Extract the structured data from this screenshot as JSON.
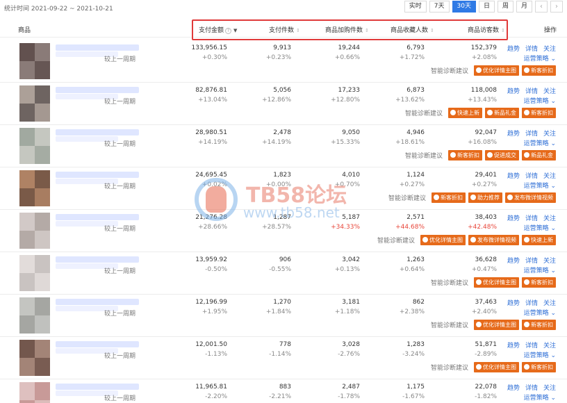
{
  "date_range": "统计时间 2021-09-22 ~ 2021-10-21",
  "range_tabs": [
    "实时",
    "7天",
    "30天",
    "日",
    "周",
    "月"
  ],
  "active_tab": "30天",
  "nav": {
    "prev": "‹",
    "next": "›"
  },
  "header": {
    "product": "商品",
    "pay_amount": "支付金额",
    "pay_items": "支付件数",
    "cart_items": "商品加购件数",
    "favorites": "商品收藏人数",
    "visitors": "商品访客数",
    "actions": "操作"
  },
  "compare_label": "较上一周期",
  "diag_label": "智能诊断建议",
  "ops": {
    "trend": "趋势",
    "detail": "详情",
    "follow": "关注",
    "strategy": "运营策略"
  },
  "colors": {
    "accent": "#2f7ae5",
    "tag": "#e66a1a",
    "highlight": "#e03a3a",
    "rise": "#e8463a"
  },
  "watermark": {
    "title": "TB58论坛",
    "url": "www.tb58.net"
  },
  "rows": [
    {
      "pay": "133,956.15",
      "pay_c": "+0.30%",
      "items": "9,913",
      "items_c": "+0.23%",
      "cart": "19,244",
      "cart_c": "+0.66%",
      "fav": "6,793",
      "fav_c": "+1.72%",
      "uv": "152,379",
      "uv_c": "+2.08%",
      "tags": [
        "优化详情主图",
        "新客折扣"
      ]
    },
    {
      "pay": "82,876.81",
      "pay_c": "+13.04%",
      "items": "5,056",
      "items_c": "+12.86%",
      "cart": "17,233",
      "cart_c": "+12.80%",
      "fav": "6,873",
      "fav_c": "+13.62%",
      "uv": "118,008",
      "uv_c": "+13.43%",
      "tags": [
        "快速上新",
        "新品礼金",
        "新客折扣"
      ]
    },
    {
      "pay": "28,980.51",
      "pay_c": "+14.19%",
      "items": "2,478",
      "items_c": "+14.19%",
      "cart": "9,050",
      "cart_c": "+15.33%",
      "fav": "4,946",
      "fav_c": "+18.61%",
      "uv": "92,047",
      "uv_c": "+16.08%",
      "tags": [
        "新客折扣",
        "促进成交",
        "新品礼金"
      ]
    },
    {
      "pay": "24,695.45",
      "pay_c": "+0.02%",
      "items": "1,823",
      "items_c": "+0.00%",
      "cart": "4,010",
      "cart_c": "+0.70%",
      "fav": "1,124",
      "fav_c": "+0.27%",
      "uv": "29,401",
      "uv_c": "+0.27%",
      "tags": [
        "新客折扣",
        "助力推荐",
        "发布微详情视频"
      ]
    },
    {
      "pay": "21,276.28",
      "pay_c": "+28.66%",
      "items": "1,287",
      "items_c": "+28.57%",
      "cart": "5,187",
      "cart_c": "+34.33%",
      "cart_red": true,
      "fav": "2,571",
      "fav_c": "+44.68%",
      "fav_red": true,
      "uv": "38,403",
      "uv_c": "+42.48%",
      "uv_red": true,
      "tags": [
        "优化详情主图",
        "发布微详情视频",
        "快速上新"
      ]
    },
    {
      "pay": "13,959.92",
      "pay_c": "-0.50%",
      "items": "906",
      "items_c": "-0.55%",
      "cart": "3,042",
      "cart_c": "+0.13%",
      "fav": "1,263",
      "fav_c": "+0.64%",
      "uv": "36,628",
      "uv_c": "+0.47%",
      "tags": [
        "优化详情主图",
        "新客折扣"
      ]
    },
    {
      "pay": "12,196.99",
      "pay_c": "+1.95%",
      "items": "1,270",
      "items_c": "+1.84%",
      "cart": "3,181",
      "cart_c": "+1.18%",
      "fav": "862",
      "fav_c": "+2.38%",
      "uv": "37,463",
      "uv_c": "+2.40%",
      "tags": [
        "优化详情主图",
        "新客折扣"
      ]
    },
    {
      "pay": "12,001.50",
      "pay_c": "-1.13%",
      "items": "778",
      "items_c": "-1.14%",
      "cart": "3,028",
      "cart_c": "-2.76%",
      "fav": "1,283",
      "fav_c": "-3.24%",
      "uv": "51,871",
      "uv_c": "-2.89%",
      "tags": [
        "优化详情主图",
        "新客折扣"
      ]
    },
    {
      "pay": "11,965.81",
      "pay_c": "-2.20%",
      "items": "883",
      "items_c": "-2.21%",
      "cart": "2,487",
      "cart_c": "-1.78%",
      "fav": "1,175",
      "fav_c": "-1.67%",
      "uv": "22,078",
      "uv_c": "-1.82%",
      "tags": [
        "新客折扣"
      ]
    }
  ]
}
